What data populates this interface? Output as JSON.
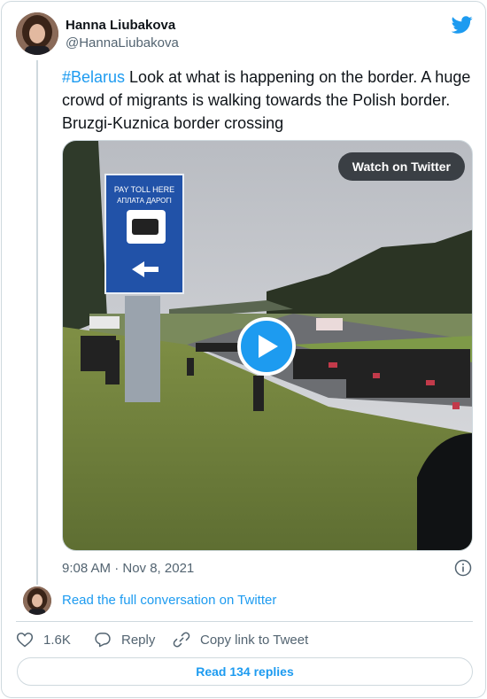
{
  "author": {
    "name": "Hanna Liubakova",
    "handle": "@HannaLiubakova"
  },
  "tweet": {
    "hashtag": "#Belarus",
    "text": " Look at what is happening on the border. A huge crowd of migrants is walking towards the Polish border.  Bruzgi-Kuznica border crossing"
  },
  "media": {
    "watch_label": "Watch on Twitter",
    "sign_text_line1": "PAY TOLL HERE",
    "sign_text_line2": "АПЛАТА ДАРОГІ"
  },
  "timestamp": "9:08 AM · Nov 8, 2021",
  "read_conversation": "Read the full conversation on Twitter",
  "actions": {
    "likes": "1.6K",
    "reply": "Reply",
    "copy_link": "Copy link to Tweet"
  },
  "replies_button": "Read 134 replies",
  "colors": {
    "accent": "#1d9bf0",
    "text": "#0f1419",
    "muted": "#536471",
    "border": "#cfd9de"
  },
  "icons": [
    "twitter-bird-icon",
    "play-icon",
    "info-icon",
    "heart-icon",
    "reply-icon",
    "link-icon"
  ]
}
